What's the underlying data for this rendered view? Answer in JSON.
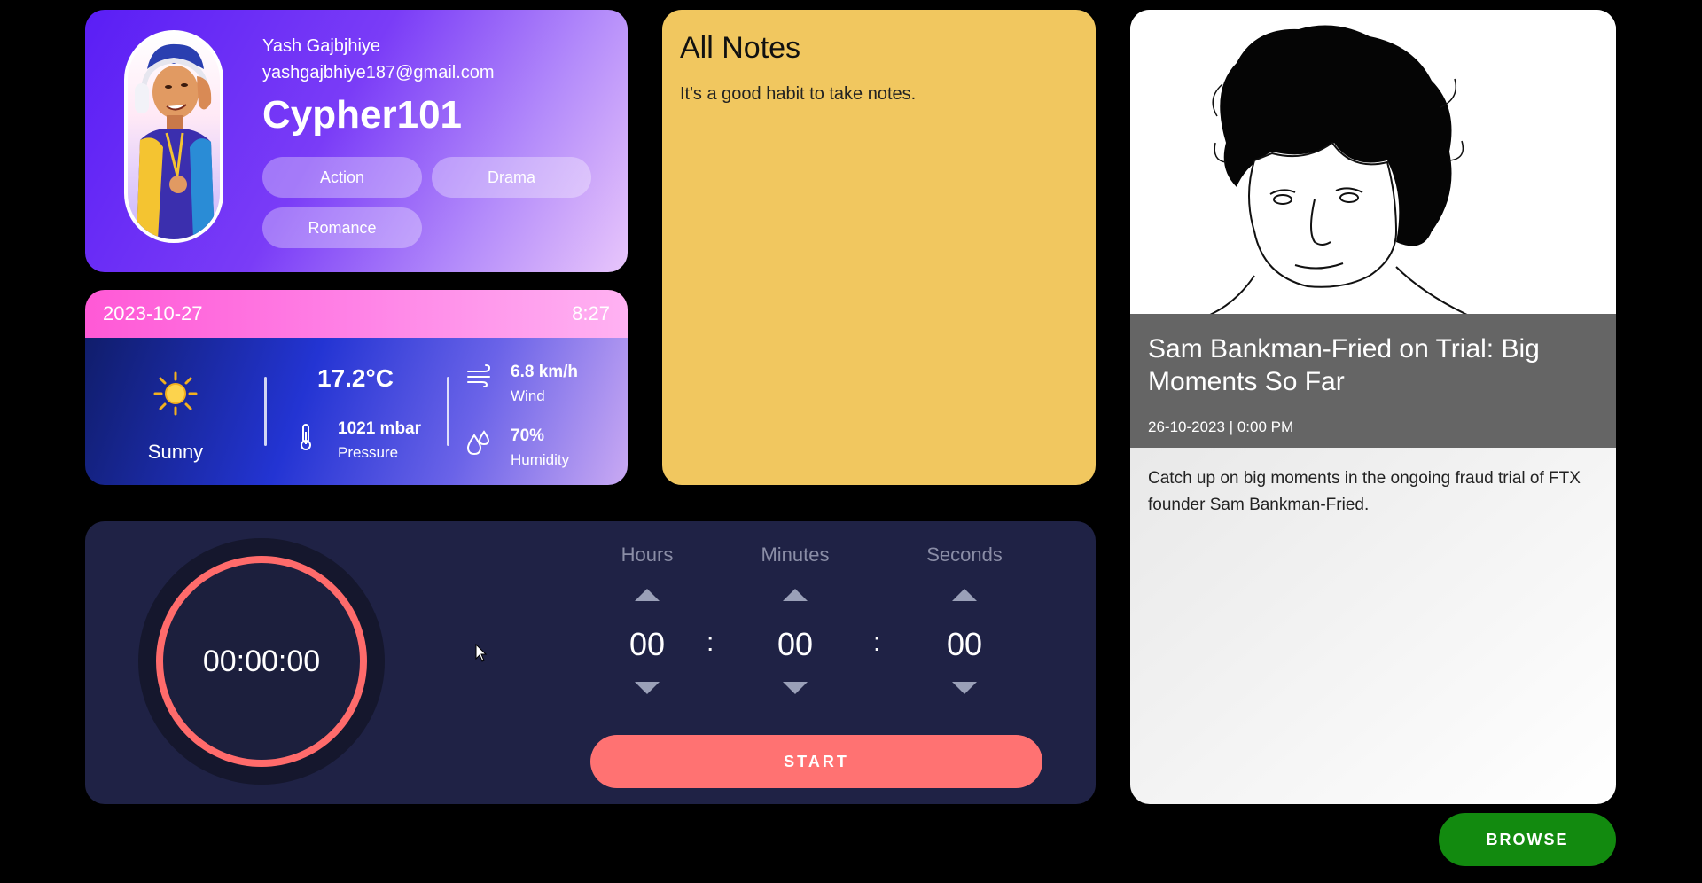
{
  "profile": {
    "name": "Yash Gajbjhiye",
    "email": "yashgajbhiye187@gmail.com",
    "username": "Cypher101",
    "genres": [
      "Action",
      "Drama",
      "Romance"
    ]
  },
  "weather": {
    "date": "2023-10-27",
    "time": "8:27",
    "condition": "Sunny",
    "temperature": "17.2°C",
    "pressure_value": "1021 mbar",
    "pressure_label": "Pressure",
    "wind_value": "6.8 km/h",
    "wind_label": "Wind",
    "humidity_value": "70%",
    "humidity_label": "Humidity",
    "icons": [
      "sun-icon",
      "thermometer-icon",
      "wind-icon",
      "humidity-icon"
    ]
  },
  "notes": {
    "title": "All Notes",
    "subtitle": "It's a good habit to take notes."
  },
  "news": {
    "title": "Sam Bankman-Fried on Trial: Big Moments So Far",
    "meta": "26-10-2023 | 0:00 PM",
    "description": "Catch up on big moments in the ongoing fraud trial of FTX founder Sam Bankman-Fried."
  },
  "timer": {
    "display": "00:00:00",
    "labels": {
      "hours": "Hours",
      "minutes": "Minutes",
      "seconds": "Seconds"
    },
    "values": {
      "hours": "00",
      "minutes": "00",
      "seconds": "00"
    },
    "separator": ":",
    "start_label": "START",
    "ring_color": "#ff6b6b"
  },
  "browse_label": "BROWSE",
  "colors": {
    "background": "#000000",
    "notes_bg": "#f1c75f",
    "timer_bg": "#1f2245",
    "start_btn": "#ff7272",
    "browse_btn": "#128a0f"
  }
}
